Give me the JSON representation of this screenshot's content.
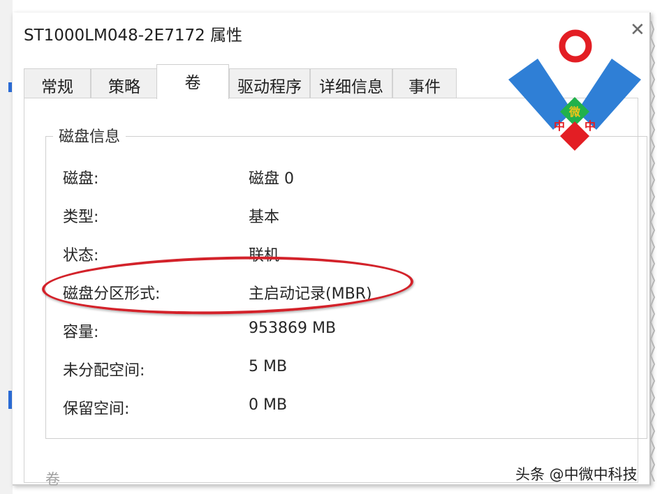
{
  "window": {
    "title": "ST1000LM048-2E7172 属性",
    "close_glyph": "✕"
  },
  "tabs": [
    {
      "label": "常规",
      "active": false
    },
    {
      "label": "策略",
      "active": false
    },
    {
      "label": "卷",
      "active": true
    },
    {
      "label": "驱动程序",
      "active": false
    },
    {
      "label": "详细信息",
      "active": false
    },
    {
      "label": "事件",
      "active": false
    }
  ],
  "disk_info": {
    "group_title": "磁盘信息",
    "rows": [
      {
        "label": "磁盘:",
        "value": "磁盘 0"
      },
      {
        "label": "类型:",
        "value": "基本"
      },
      {
        "label": "状态:",
        "value": "联机"
      },
      {
        "label": "磁盘分区形式:",
        "value": "主启动记录(MBR)"
      },
      {
        "label": "容量:",
        "value": "953869 MB"
      },
      {
        "label": "未分配空间:",
        "value": "5 MB"
      },
      {
        "label": "保留空间:",
        "value": "0 MB"
      }
    ]
  },
  "footer": {
    "volumes_label": "卷"
  },
  "annotation": {
    "highlighted_row": "磁盘分区形式:",
    "color": "#d3222a"
  },
  "logo": {
    "text": "微中中",
    "colors": {
      "blue": "#2f7fd6",
      "red": "#e31e24",
      "green": "#21b14b"
    }
  },
  "watermark": {
    "text": "头条 @中微中科技"
  }
}
